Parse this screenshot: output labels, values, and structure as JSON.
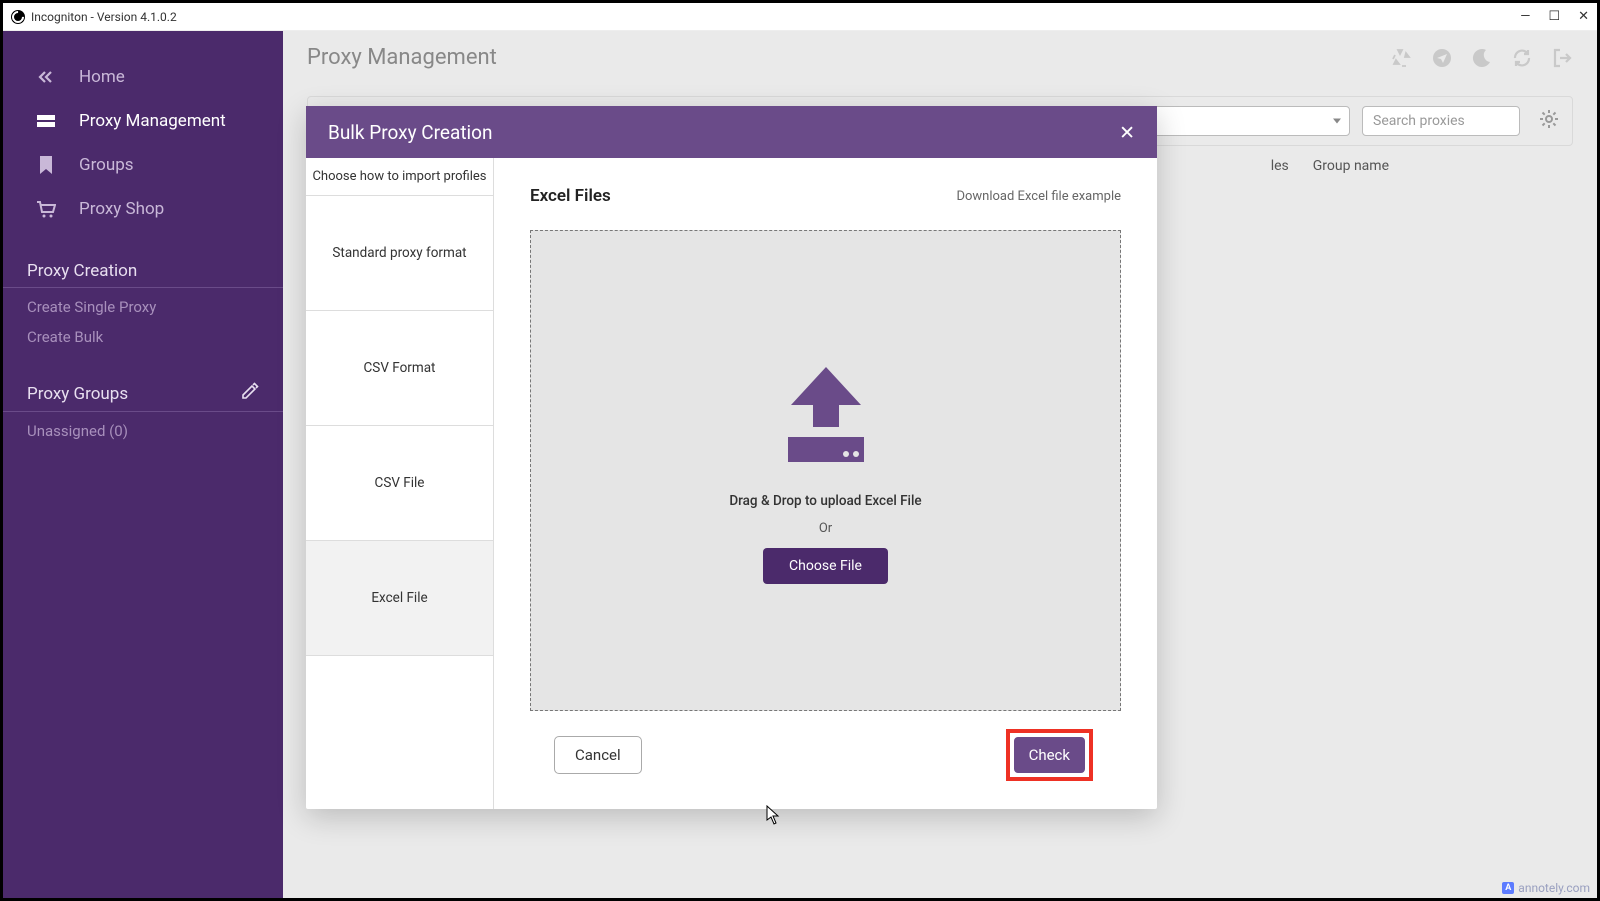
{
  "titlebar": {
    "text": "Incogniton - Version 4.1.0.2"
  },
  "sidebar": {
    "items": [
      {
        "label": "Home"
      },
      {
        "label": "Proxy Management"
      },
      {
        "label": "Groups"
      },
      {
        "label": "Proxy Shop"
      }
    ],
    "sections": {
      "creation": {
        "title": "Proxy Creation",
        "links": [
          "Create Single Proxy",
          "Create Bulk"
        ]
      },
      "groups": {
        "title": "Proxy Groups",
        "links": [
          "Unassigned (0)"
        ]
      }
    }
  },
  "page": {
    "title": "Proxy Management"
  },
  "filter": {
    "search_placeholder": "Search proxies"
  },
  "table_cols": {
    "c1": "les",
    "c2": "Group name"
  },
  "modal": {
    "title": "Bulk Proxy Creation",
    "side_head": "Choose how to import profiles",
    "options": [
      "Standard proxy format",
      "CSV Format",
      "CSV File",
      "Excel File"
    ],
    "main_title": "Excel Files",
    "download_link": "Download Excel file example",
    "drag_text": "Drag & Drop to upload Excel File",
    "or_text": "Or",
    "choose_file": "Choose File",
    "cancel": "Cancel",
    "check": "Check"
  },
  "watermark": "annotely.com"
}
